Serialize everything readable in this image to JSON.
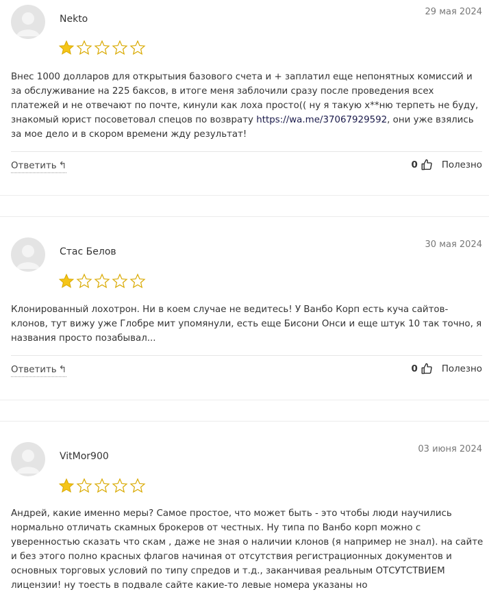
{
  "reviews": [
    {
      "author": "Nekto",
      "date": "29 мая 2024",
      "rating": 1,
      "text_before_link": "Внес 1000 долларов для открытыия базового счета и + заплатил еще непонятных комиссий и за обслуживание на 225 баксов, в итоге меня заблочили сразу после проведения всех платежей и не отвечают по почте, кинули как лоха просто(( ну я такую х**ню терпеть не буду, знакомый юрист посоветовал спецов по возврату ",
      "link": "https://wa.me/37067929592",
      "text_after_link": ", они уже взялись за мое дело и в скором времени жду результат!",
      "reply_label": "Ответить",
      "likes": "0",
      "useful_label": "Полезно"
    },
    {
      "author": "Стас Белов",
      "date": "30 мая 2024",
      "rating": 1,
      "text": "Клонированный лохотрон. Ни в коем случае не ведитесь! У Ванбо Корп есть куча сайтов-клонов, тут вижу уже Глобре мит упомянули, есть еще Бисони Онси и еще штук 10 так точно, я названия просто позабывал...",
      "reply_label": "Ответить",
      "likes": "0",
      "useful_label": "Полезно"
    },
    {
      "author": "VitMor900",
      "date": "03 июня 2024",
      "rating": 1,
      "text": "Андрей, какие именно меры? Самое простое, что может быть - это чтобы люди научились нормально отличать скамных брокеров от честных. Ну типа по Ванбо корп можно с уверенностью сказать что скам , даже не зная о наличии клонов (я например не знал). на сайте и без этого полно красных флагов начиная от отсутствия регистрационных документов и основных торговых условий по типу спредов и т.д., заканчивая реальным ОТСУТСТВИЕМ лицензии! ну тоесть в подвале сайте какие-то левые номера указаны но"
    }
  ],
  "colors": {
    "star_filled": "#f5c518",
    "star_empty_stroke": "#d9a900"
  }
}
